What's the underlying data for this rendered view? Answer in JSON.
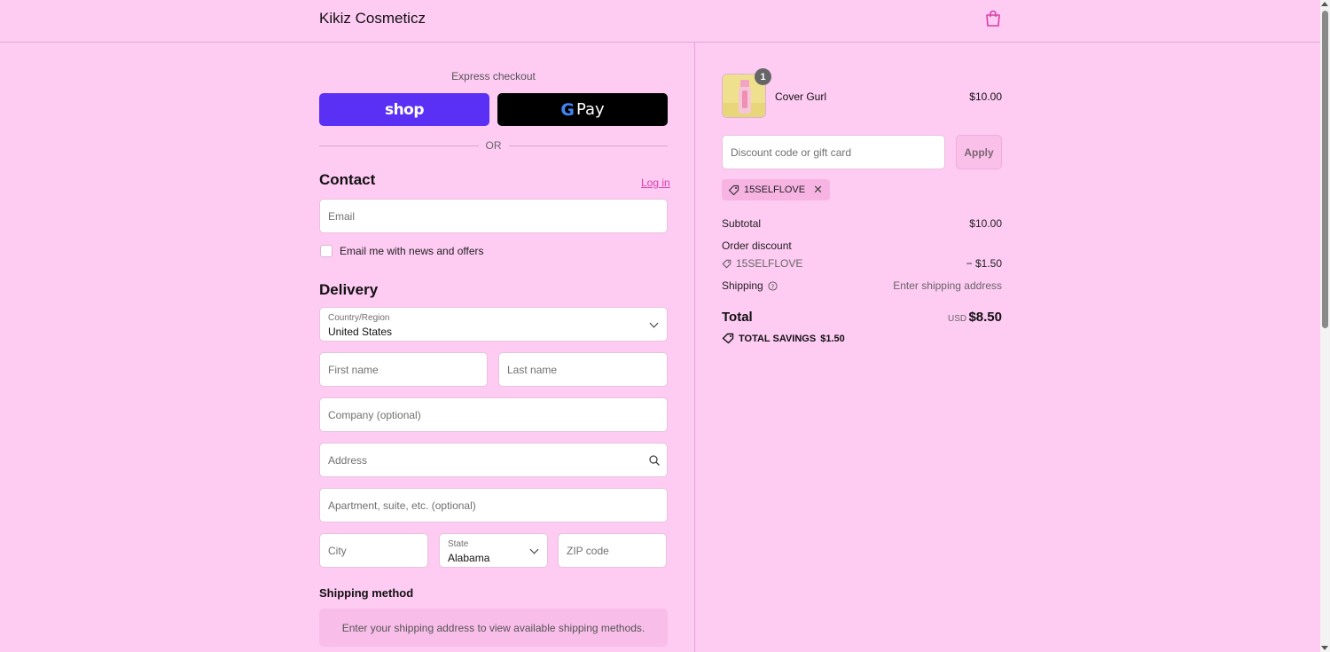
{
  "header": {
    "brand": "Kikiz Cosmeticz",
    "cart_icon": "shopping-bag-icon"
  },
  "express": {
    "label": "Express checkout",
    "shop_label": "shop",
    "gpay_g": "G",
    "gpay_label": "Pay",
    "or_label": "OR"
  },
  "contact": {
    "title": "Contact",
    "login_label": "Log in",
    "email_placeholder": "Email",
    "news_label": "Email me with news and offers"
  },
  "delivery": {
    "title": "Delivery",
    "country_label": "Country/Region",
    "country_value": "United States",
    "first_name_placeholder": "First name",
    "last_name_placeholder": "Last name",
    "company_placeholder": "Company (optional)",
    "address_placeholder": "Address",
    "apartment_placeholder": "Apartment, suite, etc. (optional)",
    "city_placeholder": "City",
    "state_label": "State",
    "state_value": "Alabama",
    "zip_placeholder": "ZIP code"
  },
  "shipping_method": {
    "title": "Shipping method",
    "message": "Enter your shipping address to view available shipping methods."
  },
  "summary": {
    "product": {
      "quantity": "1",
      "name": "Cover Gurl",
      "price": "$10.00"
    },
    "discount_placeholder": "Discount code or gift card",
    "apply_label": "Apply",
    "applied_code": "15SELFLOVE",
    "subtotal_label": "Subtotal",
    "subtotal_value": "$10.00",
    "order_discount_label": "Order discount",
    "discount_code": "15SELFLOVE",
    "discount_value": "− $1.50",
    "shipping_label": "Shipping",
    "shipping_value": "Enter shipping address",
    "total_label": "Total",
    "total_currency": "USD",
    "total_value": "$8.50",
    "savings_label": "TOTAL SAVINGS",
    "savings_value": "$1.50"
  },
  "colors": {
    "background": "#fecbf3",
    "accent": "#d93fa8",
    "shop_pay": "#5a31f4"
  }
}
